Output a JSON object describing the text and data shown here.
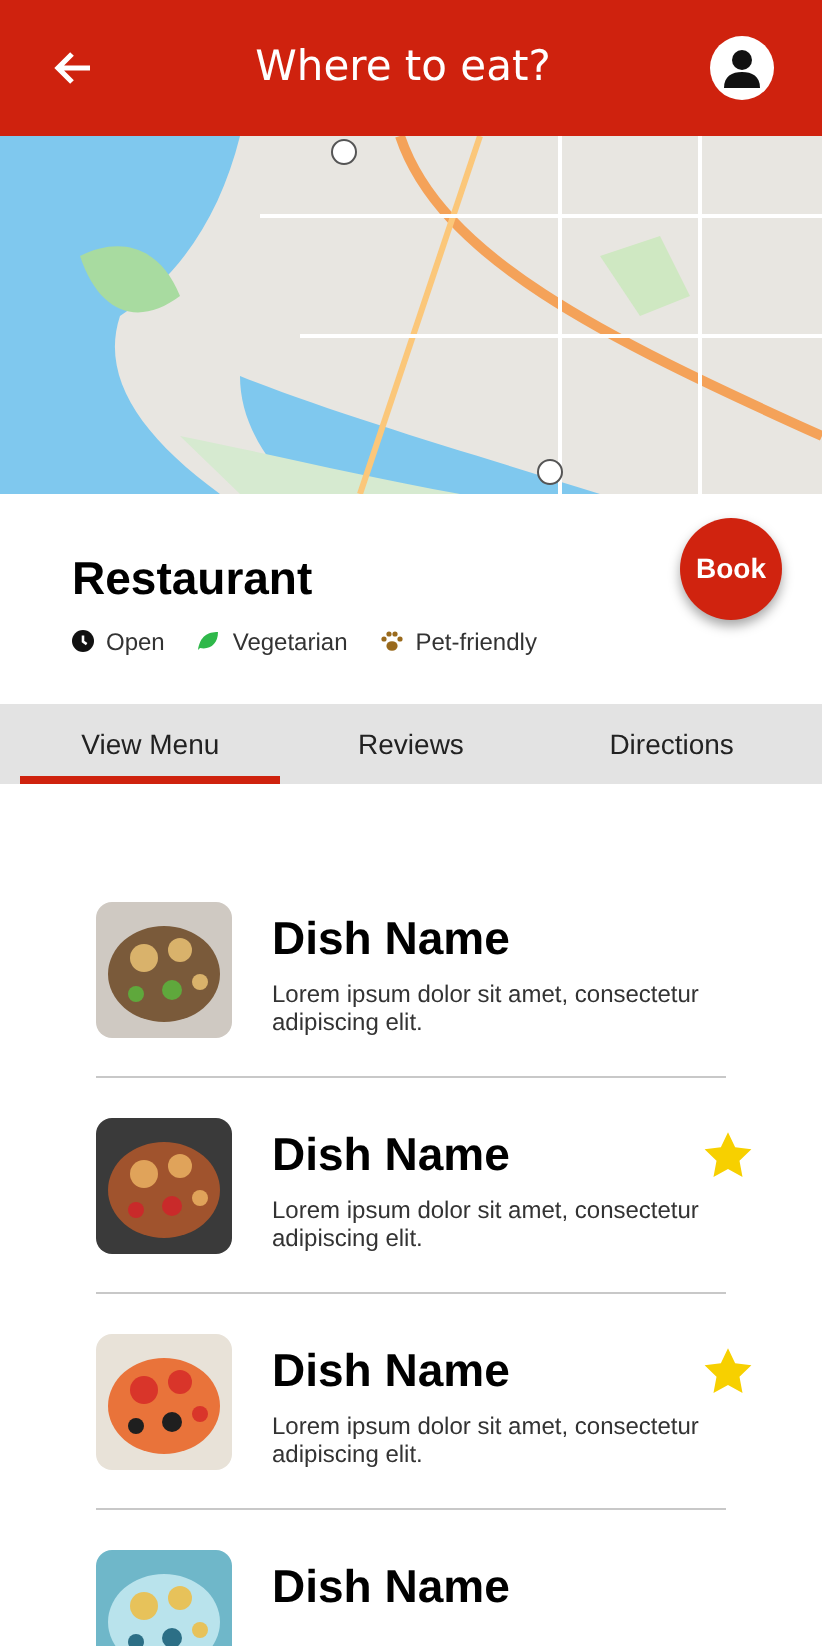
{
  "header": {
    "title": "Where to eat?"
  },
  "restaurant": {
    "name": "Restaurant",
    "book_label": "Book",
    "tags": [
      {
        "kind": "clock",
        "label": "Open"
      },
      {
        "kind": "leaf",
        "label": "Vegetarian"
      },
      {
        "kind": "paw",
        "label": "Pet-friendly"
      }
    ]
  },
  "tabs": [
    {
      "label": "View Menu",
      "selected": true
    },
    {
      "label": "Reviews",
      "selected": false
    },
    {
      "label": "Directions",
      "selected": false
    }
  ],
  "dishes": [
    {
      "name": "Dish Name",
      "description": "Lorem ipsum dolor sit amet, consectetur adipiscing elit.",
      "favorite": false
    },
    {
      "name": "Dish Name",
      "description": "Lorem ipsum dolor sit amet, consectetur adipiscing elit.",
      "favorite": true
    },
    {
      "name": "Dish Name",
      "description": "Lorem ipsum dolor sit amet, consectetur adipiscing elit.",
      "favorite": true
    },
    {
      "name": "Dish Name",
      "favorite": false
    }
  ]
}
